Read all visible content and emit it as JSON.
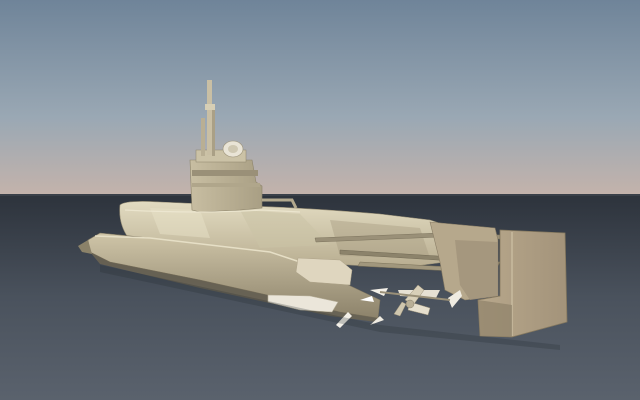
{
  "scene": {
    "subject": "submarine-3d-render",
    "colors": {
      "sky_top": "#6f8499",
      "sky_mid": "#9aa8b4",
      "horizon_glow": "#c4b3ab",
      "ground_near": "#2d333c",
      "ground_far": "#525a66",
      "hull_light": "#d9d0b4",
      "hull_mid": "#b5aa8c",
      "hull_dark": "#8a7f66",
      "wood_light": "#c8b89a",
      "wood_dark": "#a08e74",
      "fin_white": "#f2efe8"
    }
  }
}
